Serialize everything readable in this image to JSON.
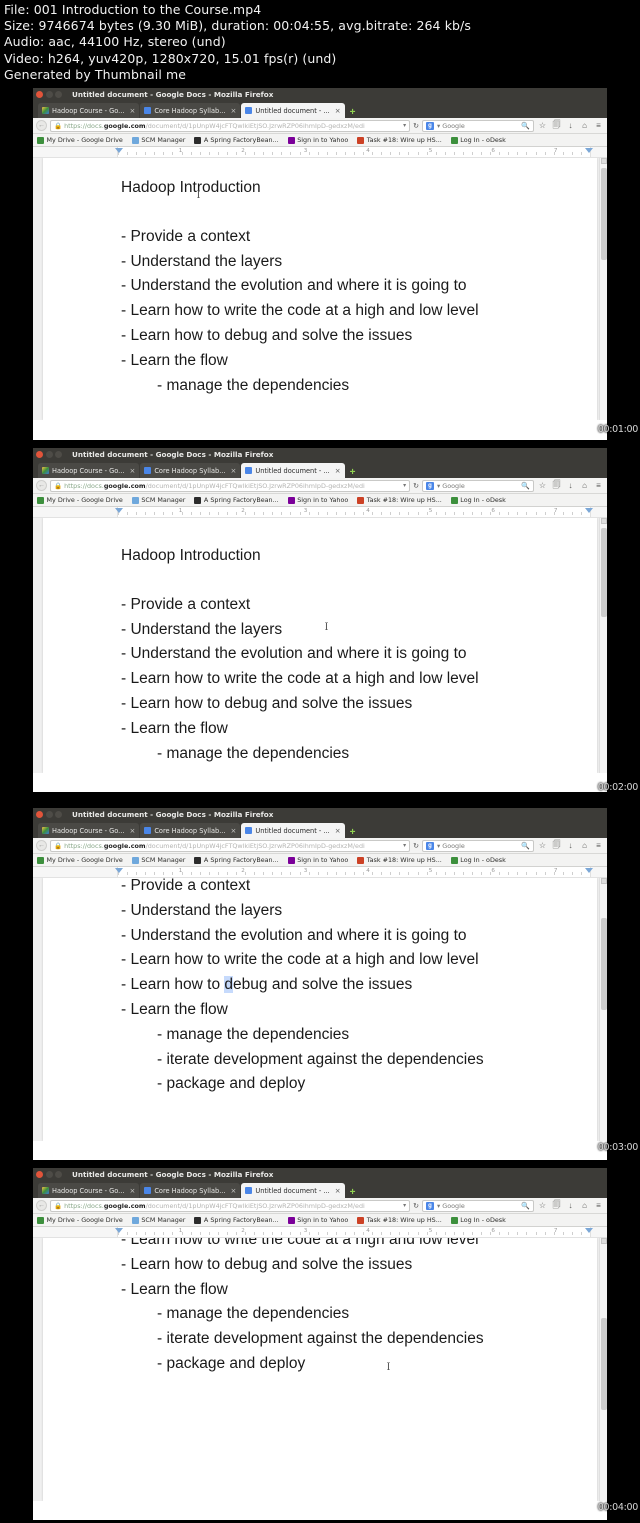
{
  "fileinfo": {
    "line1": "File: 001 Introduction to the Course.mp4",
    "line2": "Size: 9746674 bytes (9.30 MiB), duration: 00:04:55, avg.bitrate: 264 kb/s",
    "line3": "Audio: aac, 44100 Hz, stereo (und)",
    "line4": "Video: h264, yuv420p, 1280x720, 15.01 fps(r) (und)",
    "line5": "Generated by Thumbnail me"
  },
  "browser": {
    "window_title": "Untitled document - Google Docs - Mozilla Firefox",
    "tabs": [
      {
        "label": "Hadoop Course - Go...",
        "close": "×",
        "icon": "drive-icon",
        "active": false
      },
      {
        "label": "Core Hadoop Syllab...",
        "close": "×",
        "icon": "docs-icon",
        "active": false
      },
      {
        "label": "Untitled document - ...",
        "close": "×",
        "icon": "docs-icon",
        "active": true
      }
    ],
    "new_tab_label": "+",
    "back_glyph": "←",
    "lock_glyph": "🔒",
    "url_scheme": "https://docs.",
    "url_domain": "google.com",
    "url_path": "/document/d/1pUnpW4jcFTQwlkiEtjSO.JzrwRZP06ihmIpD-gedxzM/edi",
    "url_caret": "▾",
    "reload_glyph": "↻",
    "search_engine_label": "▾ Google",
    "search_glyph": "🔍",
    "toolbar_icons": [
      "☆",
      "🗐",
      "↓",
      "⌂",
      "≡"
    ],
    "bookmarks": [
      {
        "label": "My Drive - Google Drive",
        "icon": "drive-icon",
        "color": "#3c8f3c"
      },
      {
        "label": "SCM Manager",
        "icon": "scm-icon",
        "color": "#6fa8dc"
      },
      {
        "label": "A Spring FactoryBean...",
        "icon": "spring-icon",
        "color": "#2b2b2b"
      },
      {
        "label": "Sign in to Yahoo",
        "icon": "yahoo-icon",
        "color": "#7b0099"
      },
      {
        "label": "Task #18: Wire up HS...",
        "icon": "task-icon",
        "color": "#cc4125"
      },
      {
        "label": "Log In - oDesk",
        "icon": "odesk-icon",
        "color": "#3c8f3c"
      }
    ]
  },
  "ruler": {
    "numbers": [
      "1",
      "2",
      "3",
      "4",
      "5",
      "6",
      "7"
    ]
  },
  "document": {
    "heading": "Hadoop Introduction",
    "lines": [
      "- Provide a context",
      "- Understand the layers",
      "- Understand the evolution and where it is going to",
      "- Learn how to write the code at a high and low level",
      "- Learn how to debug and solve the issues",
      "- Learn the flow"
    ],
    "sublines": [
      "- manage the dependencies",
      "- iterate development against the dependencies",
      "- package and deploy"
    ],
    "debug_prefix": "- Learn how to ",
    "debug_selected": "d",
    "debug_suffix": "ebug and solve the issues"
  },
  "frames": [
    {
      "timestamp": "00:01:00"
    },
    {
      "timestamp": "00:02:00"
    },
    {
      "timestamp": "00:03:00"
    },
    {
      "timestamp": "00:04:00"
    }
  ],
  "colors": {
    "background": "#000000",
    "chrome_dark": "#3c3b37",
    "toolbar": "#f3f3f2",
    "selection": "#c6dafc",
    "accent_blue": "#4a86e8"
  }
}
